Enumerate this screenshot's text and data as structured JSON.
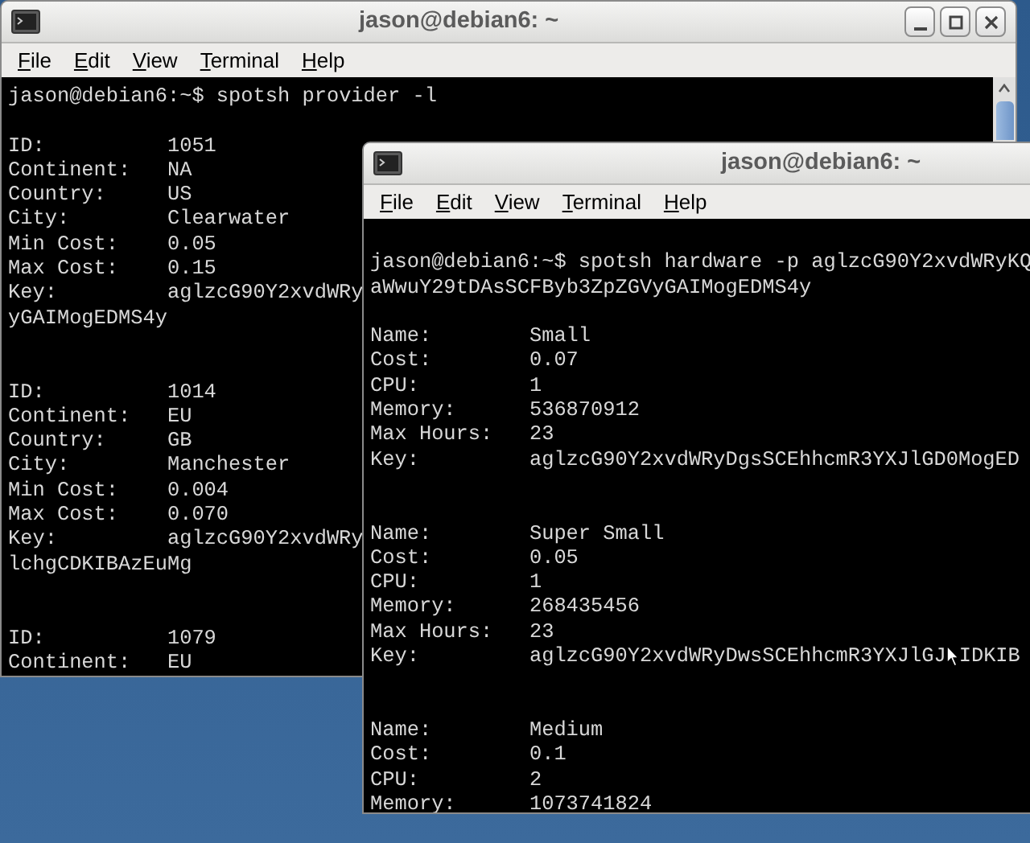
{
  "windows": [
    {
      "title": "jason@debian6: ~",
      "menu": [
        "File",
        "Edit",
        "View",
        "Terminal",
        "Help"
      ],
      "lines": [
        {
          "kind": "text",
          "text": "jason@debian6:~$ spotsh provider -l"
        },
        {
          "kind": "blank"
        },
        {
          "kind": "field",
          "label": "ID:",
          "value": "1051"
        },
        {
          "kind": "field",
          "label": "Continent:",
          "value": "NA"
        },
        {
          "kind": "field",
          "label": "Country:",
          "value": "US"
        },
        {
          "kind": "field",
          "label": "City:",
          "value": "Clearwater"
        },
        {
          "kind": "field",
          "label": "Min Cost:",
          "value": "0.05"
        },
        {
          "kind": "field",
          "label": "Max Cost:",
          "value": "0.15"
        },
        {
          "kind": "field",
          "label": "Key:",
          "value": "aglzcG90Y2xvdWRy"
        },
        {
          "kind": "text",
          "text": "yGAIMogEDMS4y"
        },
        {
          "kind": "blank"
        },
        {
          "kind": "blank"
        },
        {
          "kind": "field",
          "label": "ID:",
          "value": "1014"
        },
        {
          "kind": "field",
          "label": "Continent:",
          "value": "EU"
        },
        {
          "kind": "field",
          "label": "Country:",
          "value": "GB"
        },
        {
          "kind": "field",
          "label": "City:",
          "value": "Manchester"
        },
        {
          "kind": "field",
          "label": "Min Cost:",
          "value": "0.004"
        },
        {
          "kind": "field",
          "label": "Max Cost:",
          "value": "0.070"
        },
        {
          "kind": "field",
          "label": "Key:",
          "value": "aglzcG90Y2xvdWRy"
        },
        {
          "kind": "text",
          "text": "lchgCDKIBAzEuMg"
        },
        {
          "kind": "blank"
        },
        {
          "kind": "blank"
        },
        {
          "kind": "field",
          "label": "ID:",
          "value": "1079"
        },
        {
          "kind": "field",
          "label": "Continent:",
          "value": "EU"
        }
      ]
    },
    {
      "title": "jason@debian6: ~",
      "menu": [
        "File",
        "Edit",
        "View",
        "Terminal",
        "Help"
      ],
      "lines": [
        {
          "kind": "blank"
        },
        {
          "kind": "text",
          "text": "jason@debian6:~$ spotsh hardware -p aglzcG90Y2xvdWRyKQ"
        },
        {
          "kind": "text",
          "text": "aWwuY29tDAsSCFByb3ZpZGVyGAIMogEDMS4y"
        },
        {
          "kind": "blank"
        },
        {
          "kind": "field",
          "label": "Name:",
          "value": "Small"
        },
        {
          "kind": "field",
          "label": "Cost:",
          "value": "0.07"
        },
        {
          "kind": "field",
          "label": "CPU:",
          "value": "1"
        },
        {
          "kind": "field",
          "label": "Memory:",
          "value": "536870912"
        },
        {
          "kind": "field",
          "label": "Max Hours:",
          "value": "23"
        },
        {
          "kind": "field",
          "label": "Key:",
          "value": "aglzcG90Y2xvdWRyDgsSCEhhcmR3YXJlGD0MogED"
        },
        {
          "kind": "blank"
        },
        {
          "kind": "blank"
        },
        {
          "kind": "field",
          "label": "Name:",
          "value": "Super Small"
        },
        {
          "kind": "field",
          "label": "Cost:",
          "value": "0.05"
        },
        {
          "kind": "field",
          "label": "CPU:",
          "value": "1"
        },
        {
          "kind": "field",
          "label": "Memory:",
          "value": "268435456"
        },
        {
          "kind": "field",
          "label": "Max Hours:",
          "value": "23"
        },
        {
          "kind": "field",
          "label": "Key:",
          "value": "aglzcG90Y2xvdWRyDwsSCEhhcmR3YXJlGJ",
          "after_pointer": "IDKIB"
        },
        {
          "kind": "blank"
        },
        {
          "kind": "blank"
        },
        {
          "kind": "field",
          "label": "Name:",
          "value": "Medium"
        },
        {
          "kind": "field",
          "label": "Cost:",
          "value": "0.1"
        },
        {
          "kind": "field",
          "label": "CPU:",
          "value": "2"
        },
        {
          "kind": "field",
          "label": "Memory:",
          "value": "1073741824"
        }
      ]
    }
  ]
}
